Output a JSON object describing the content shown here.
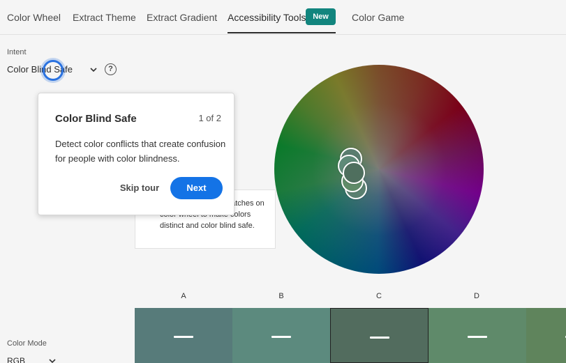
{
  "tabs": [
    {
      "label": "Color Wheel"
    },
    {
      "label": "Extract Theme"
    },
    {
      "label": "Extract Gradient"
    },
    {
      "label": "Accessibility Tools"
    },
    {
      "label": "Color Game"
    }
  ],
  "badge": {
    "new": "New"
  },
  "intent": {
    "label": "Intent",
    "value": "Color Blind Safe"
  },
  "help": {
    "glyph": "?"
  },
  "popover": {
    "title": "Color Blind Safe",
    "step": "1 of 2",
    "description": "Detect color conflicts that create confusion for people with color blindness.",
    "skip": "Skip tour",
    "next": "Next"
  },
  "hint": {
    "text": "conflict. Move the swatches on color wheel to make colors distinct and color blind safe."
  },
  "swatches": [
    {
      "label": "A",
      "color": "#577b7a"
    },
    {
      "label": "B",
      "color": "#5c8a7e"
    },
    {
      "label": "C",
      "color": "#526c5e"
    },
    {
      "label": "D",
      "color": "#5f8a6a"
    },
    {
      "label": "",
      "color": "#5f845c"
    }
  ],
  "color_mode": {
    "label": "Color Mode",
    "value": "RGB"
  },
  "colors": {
    "accent": "#1473e6",
    "badge": "#12857e"
  }
}
